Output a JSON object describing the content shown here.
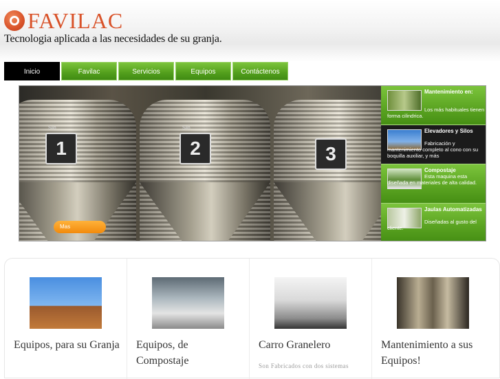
{
  "brand": {
    "name": "FAVILAC",
    "tagline": "Tecnologia aplicada a las necesidades de su granja."
  },
  "nav": {
    "items": [
      "Inicio",
      "Favilac",
      "Servicios",
      "Equipos",
      "Contáctenos"
    ],
    "active": "Inicio"
  },
  "banner": {
    "silo_tag": "Silo",
    "silo_numbers": [
      "1",
      "2",
      "3"
    ],
    "more_label": "Mas",
    "side_items": [
      {
        "title": "Mantenimiento en:",
        "desc": "Los más habituales tienen forma cilindrica."
      },
      {
        "title": "Elevadores y Silos",
        "desc": "Fabricación y mantenimiento completo al cono con su boquilla auxiliar, y más"
      },
      {
        "title": "Compostaje",
        "desc": "Esta maquina esta diseñada en materiales de alta calidad."
      },
      {
        "title": "Jaulas Automatizadas",
        "desc": "Diseñadas al gusto del cliente."
      }
    ]
  },
  "cards": [
    {
      "title": "Equipos, para su Granja",
      "text": ""
    },
    {
      "title": "Equipos, de Compostaje",
      "text": ""
    },
    {
      "title": "Carro Granelero",
      "text": "Son Fabricados con dos sistemas"
    },
    {
      "title": "Mantenimiento a sus Equipos!",
      "text": ""
    }
  ],
  "colors": {
    "brand": "#d9532a",
    "nav_green": "#56a21e",
    "nav_active": "#000000",
    "more_orange": "#f28a0c"
  }
}
